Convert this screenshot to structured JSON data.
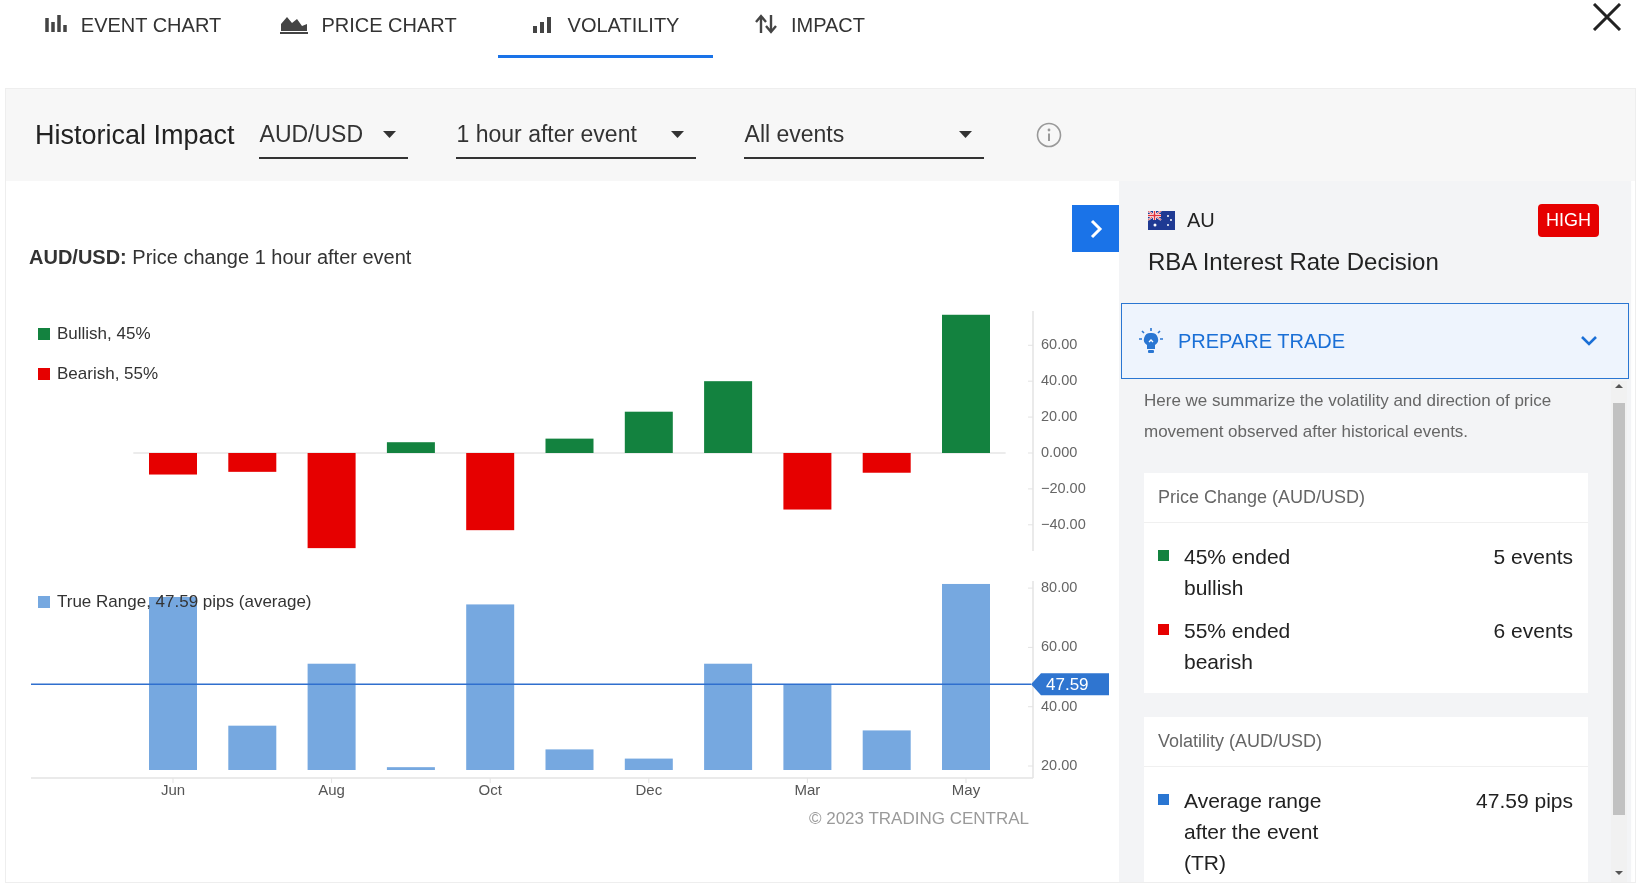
{
  "tabs": [
    {
      "label": "EVENT CHART",
      "selected": false
    },
    {
      "label": "PRICE CHART",
      "selected": false
    },
    {
      "label": "VOLATILITY",
      "selected": true
    },
    {
      "label": "IMPACT",
      "selected": false
    }
  ],
  "header": {
    "title": "Historical Impact",
    "dropdowns": [
      {
        "value": "AUD/USD"
      },
      {
        "value": "1 hour after event"
      },
      {
        "value": "All events"
      }
    ]
  },
  "chart_title": "**AUD/USD:** Price change 1 hour after event",
  "price_change_chart": {
    "chart_data": {
      "type": "bar",
      "categories": [
        null,
        null,
        null,
        null,
        null,
        null,
        null,
        null,
        null,
        null,
        null
      ],
      "stacked": true,
      "ylim": [
        -54.6,
        79.1
      ],
      "series": [
        {
          "name": "Bullish, 45%",
          "color": "#13823f",
          "values": [
            null,
            null,
            null,
            6,
            null,
            8,
            23,
            40,
            null,
            null,
            77
          ]
        },
        {
          "name": "Bearish, 55%",
          "color": "#e60000",
          "values": [
            -12,
            -10.5,
            -53,
            null,
            -43,
            null,
            null,
            null,
            -31.5,
            -11,
            null
          ]
        }
      ],
      "yticks": [
        {
          "value": -40,
          "label": "−40.00"
        },
        {
          "value": -20,
          "label": "−20.00"
        },
        {
          "value": 0,
          "label": "0.000"
        },
        {
          "value": 20,
          "label": "20.00"
        },
        {
          "value": 40,
          "label": "40.00"
        },
        {
          "value": 60,
          "label": "60.00"
        }
      ]
    }
  },
  "true_range_chart": {
    "chart_data": {
      "type": "bar",
      "categories": [
        "Jun",
        null,
        "Aug",
        null,
        "Oct",
        null,
        "Dec",
        null,
        "Mar",
        null,
        "May"
      ],
      "ylim": [
        18.65,
        82.4
      ],
      "series": [
        {
          "name": "True Range, 47.59 pips (average)",
          "color": "#76a8e0",
          "values": [
            77,
            33.6,
            54.5,
            19.6,
            74.5,
            25.6,
            22.5,
            54.5,
            47.5,
            32,
            81.4
          ]
        }
      ],
      "yticks": [
        {
          "value": 20,
          "label": "20.00"
        },
        {
          "value": 40,
          "label": "40.00"
        },
        {
          "value": 60,
          "label": "60.00"
        },
        {
          "value": 80,
          "label": "80.00"
        }
      ],
      "ref_lines": [
        {
          "axis": "y",
          "value": 47.59,
          "label": "47.59"
        }
      ]
    }
  },
  "copyright": "© 2023 TRADING CENTRAL",
  "event": {
    "country": "AU",
    "impact": "HIGH",
    "title": "RBA Interest Rate Decision"
  },
  "prepare_trade": {
    "label": "PREPARE TRADE",
    "expanded": true,
    "description": "Here we summarize the volatility and direction of price movement observed after historical events.",
    "sections": [
      {
        "title": "Price Change (AUD/USD)",
        "rows": [
          {
            "label": "45% ended bullish",
            "value": "5 events",
            "color": "#13823f"
          },
          {
            "label": "55% ended bearish",
            "value": "6 events",
            "color": "#e60000"
          }
        ]
      },
      {
        "title": "Volatility (AUD/USD)",
        "rows": [
          {
            "label": "Average range after the event (TR)",
            "value": "47.59 pips",
            "color": "#2a76d2"
          }
        ]
      }
    ]
  }
}
